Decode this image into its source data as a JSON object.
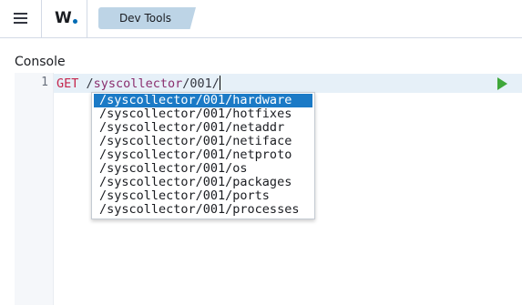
{
  "header": {
    "logo_text": "W",
    "breadcrumb_label": "Dev Tools"
  },
  "console": {
    "section_title": "Console",
    "line_number": "1",
    "method": "GET",
    "path_prefix": "/",
    "path_word": "syscollector",
    "path_suffix": "/001/"
  },
  "autocomplete": {
    "items": [
      "/syscollector/001/hardware",
      "/syscollector/001/hotfixes",
      "/syscollector/001/netaddr",
      "/syscollector/001/netiface",
      "/syscollector/001/netproto",
      "/syscollector/001/os",
      "/syscollector/001/packages",
      "/syscollector/001/ports",
      "/syscollector/001/processes"
    ],
    "selected_index": 0
  },
  "colors": {
    "accent": "#006bb4",
    "breadcrumb_bg": "#bdd4e6",
    "run_button": "#3fa73a",
    "selection": "#1b7ac6"
  }
}
